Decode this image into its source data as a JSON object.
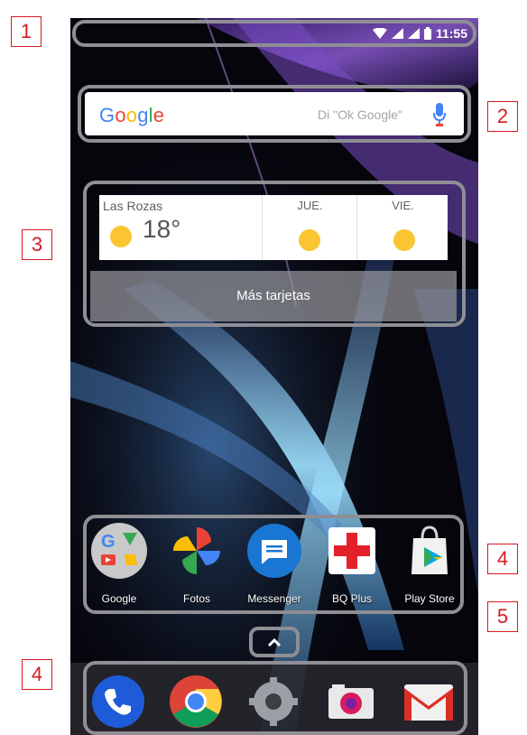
{
  "callouts": [
    "1",
    "2",
    "3",
    "4",
    "5",
    "4"
  ],
  "status_bar": {
    "time": "11:55"
  },
  "search": {
    "logo": "Google",
    "hint": "Di \"Ok Google\""
  },
  "weather": {
    "location": "Las Rozas",
    "temperature": "18°",
    "days": [
      {
        "label": "JUE."
      },
      {
        "label": "VIE."
      }
    ]
  },
  "cards": {
    "more_label": "Más tarjetas"
  },
  "apps": [
    {
      "label": "Google",
      "icon": "google-folder-icon"
    },
    {
      "label": "Fotos",
      "icon": "photos-pinwheel-icon"
    },
    {
      "label": "Messenger",
      "icon": "messenger-icon"
    },
    {
      "label": "BQ Plus",
      "icon": "bq-plus-icon"
    },
    {
      "label": "Play Store",
      "icon": "play-store-icon"
    }
  ],
  "dock": [
    {
      "icon": "phone-icon"
    },
    {
      "icon": "chrome-icon"
    },
    {
      "icon": "settings-gear-icon"
    },
    {
      "icon": "camera-icon"
    },
    {
      "icon": "gmail-icon"
    }
  ],
  "colors": {
    "callout_red": "#d71920",
    "highlight_gray": "#8e8e94",
    "wallpaper_violet": "#6b3fa8",
    "wallpaper_cyan": "#7fd6ff",
    "sun_yellow": "#fbc531"
  }
}
